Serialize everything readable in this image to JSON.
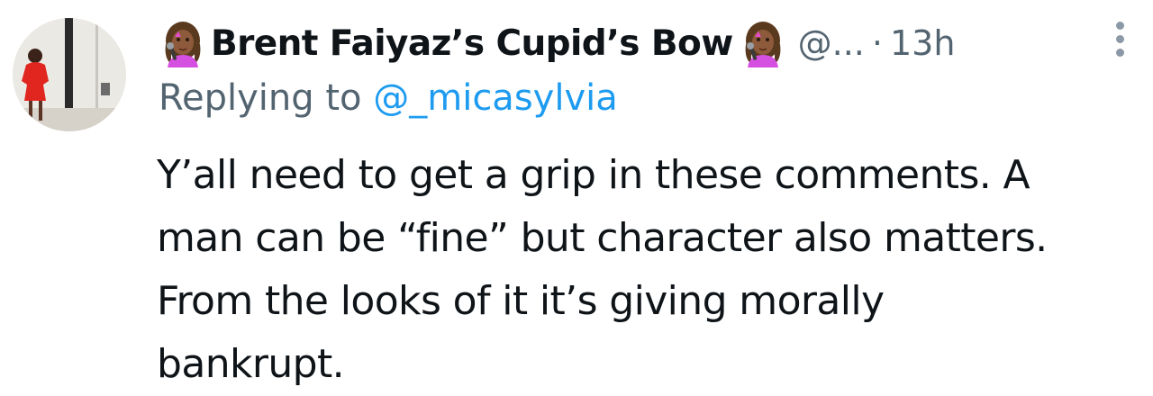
{
  "tweet": {
    "display_name": "Brent Faiyaz’s Cupid’s Bow",
    "name_emoji": "woman-singer-emoji",
    "handle": "@...",
    "separator": "·",
    "time": "13h",
    "more_icon": "more-vertical-icon",
    "reply_prefix": "Replying to",
    "reply_handle": "@_micasylvia",
    "body_lines": [
      "Y’all need to get a grip in these comments. A",
      "man can be “fine” but character also matters.",
      "From the looks of it it’s giving morally",
      "bankrupt."
    ]
  },
  "colors": {
    "text": "#0f1419",
    "secondary": "#536471",
    "link": "#1d9bf0",
    "dots": "#8b98a5"
  }
}
